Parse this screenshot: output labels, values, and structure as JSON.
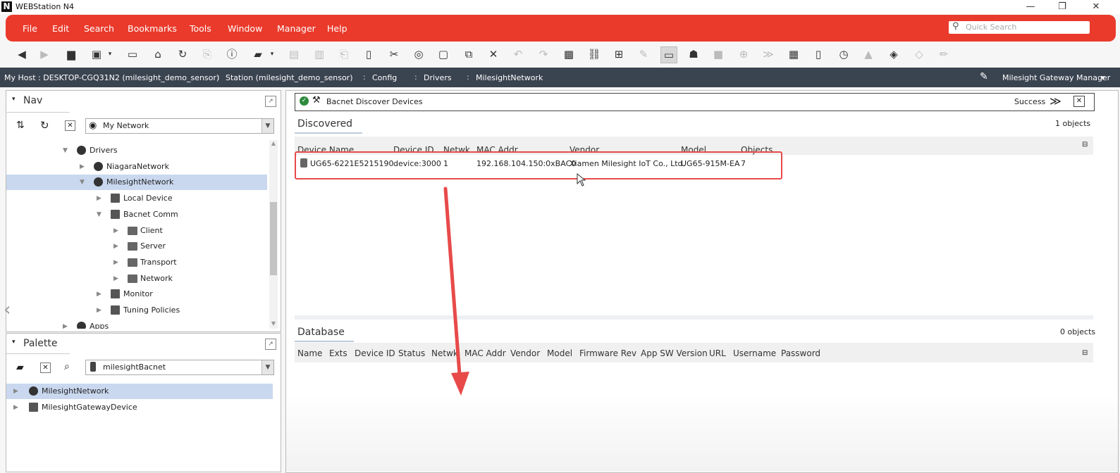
{
  "window": {
    "logo_letter": "N",
    "title": "WEBStation N4",
    "minimize": "—",
    "maximize": "❐",
    "close": "✕"
  },
  "menu": [
    "File",
    "Edit",
    "Search",
    "Bookmarks",
    "Tools",
    "Window",
    "Manager",
    "Help"
  ],
  "quick_search": {
    "placeholder": "Quick Search"
  },
  "path": {
    "items": [
      "My Host : DESKTOP-CGQ31N2 (milesight_demo_sensor)",
      "Station (milesight_demo_sensor)",
      "Config",
      "Drivers",
      "MilesightNetwork"
    ],
    "view_selector": "Milesight Gateway Manager"
  },
  "nav": {
    "title": "Nav",
    "combo_value": "My Network",
    "tree": [
      {
        "label": "Drivers",
        "indent": 0,
        "open": true,
        "icon": "drivers-icon"
      },
      {
        "label": "NiagaraNetwork",
        "indent": 1,
        "open": false,
        "icon": "network-icon"
      },
      {
        "label": "MilesightNetwork",
        "indent": 1,
        "open": true,
        "icon": "network-icon",
        "selected": true
      },
      {
        "label": "Local Device",
        "indent": 2,
        "open": false,
        "icon": "device-icon"
      },
      {
        "label": "Bacnet Comm",
        "indent": 2,
        "open": true,
        "icon": "comm-icon"
      },
      {
        "label": "Client",
        "indent": 3,
        "open": false,
        "icon": "folder-icon"
      },
      {
        "label": "Server",
        "indent": 3,
        "open": false,
        "icon": "folder-icon"
      },
      {
        "label": "Transport",
        "indent": 3,
        "open": false,
        "icon": "folder-icon"
      },
      {
        "label": "Network",
        "indent": 3,
        "open": false,
        "icon": "folder-icon"
      },
      {
        "label": "Monitor",
        "indent": 2,
        "open": false,
        "icon": "monitor-icon"
      },
      {
        "label": "Tuning Policies",
        "indent": 2,
        "open": false,
        "icon": "tuning-icon"
      },
      {
        "label": "Apps",
        "indent": 0,
        "open": false,
        "icon": "apps-icon"
      }
    ]
  },
  "palette": {
    "title": "Palette",
    "combo_value": "milesightBacnet",
    "items": [
      {
        "label": "MilesightNetwork",
        "selected": true
      },
      {
        "label": "MilesightGatewayDevice",
        "selected": false
      }
    ]
  },
  "view_header": {
    "title": "Bacnet Discover Devices",
    "status": "Success"
  },
  "discovered": {
    "title": "Discovered",
    "count": "1 objects",
    "columns": [
      "Device Name",
      "Device ID",
      "Netwk",
      "MAC Addr",
      "Vendor",
      "Model",
      "Objects"
    ],
    "rows": [
      [
        "UG65-6221E5215190",
        "device:3000",
        "1",
        "192.168.104.150:0xBAC0",
        "Xiamen Milesight IoT Co., Ltd.",
        "UG65-915M-EA",
        "7"
      ]
    ]
  },
  "database": {
    "title": "Database",
    "count": "0 objects",
    "columns": [
      "Name",
      "Exts",
      "Device ID",
      "Status",
      "Netwk",
      "MAC Addr",
      "Vendor",
      "Model",
      "Firmware Rev",
      "App SW Version",
      "URL",
      "Username",
      "Password"
    ]
  },
  "colors": {
    "menu_red": "#ea3a2b",
    "path_bar": "#3a4350",
    "selection": "#c9d8ef",
    "highlight_box": "#e84a4a",
    "arrow": "#e84a4a"
  }
}
